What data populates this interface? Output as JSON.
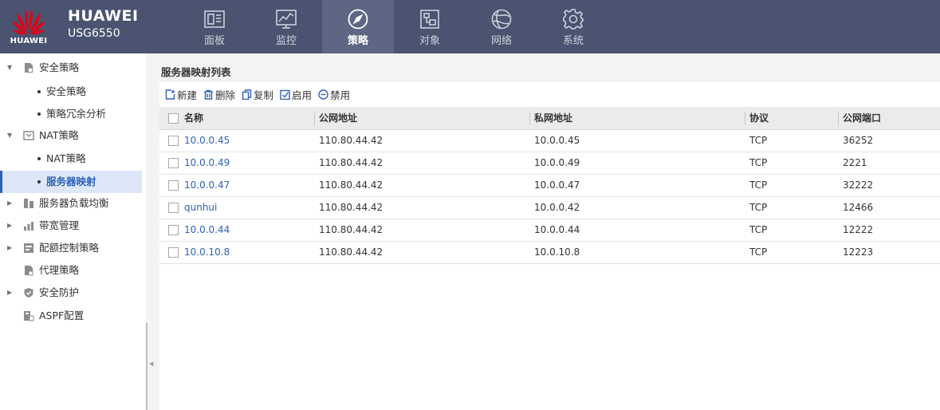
{
  "header": {
    "logo_text": "HUAWEI",
    "brand_name": "HUAWEI",
    "model": "USG6550",
    "brand_color": "#e60012",
    "nav": [
      {
        "label": "面板",
        "icon": "dashboard-icon",
        "active": false
      },
      {
        "label": "监控",
        "icon": "monitor-chart-icon",
        "active": false
      },
      {
        "label": "策略",
        "icon": "compass-icon",
        "active": true
      },
      {
        "label": "对象",
        "icon": "object-icon",
        "active": false
      },
      {
        "label": "网络",
        "icon": "globe-icon",
        "active": false
      },
      {
        "label": "系统",
        "icon": "gear-icon",
        "active": false
      }
    ]
  },
  "sidebar": {
    "items": [
      {
        "label": "安全策略",
        "icon": "security-policy-icon",
        "arrow": "expanded"
      },
      {
        "label": "安全策略",
        "sub": true
      },
      {
        "label": "策略冗余分析",
        "sub": true
      },
      {
        "label": "NAT策略",
        "icon": "nat-icon",
        "arrow": "expanded"
      },
      {
        "label": "NAT策略",
        "sub": true
      },
      {
        "label": "服务器映射",
        "sub": true,
        "selected": true
      },
      {
        "label": "服务器负载均衡",
        "icon": "server-lb-icon",
        "arrow": "collapsed"
      },
      {
        "label": "带宽管理",
        "icon": "bandwidth-icon",
        "arrow": "collapsed"
      },
      {
        "label": "配额控制策略",
        "icon": "quota-icon",
        "arrow": "collapsed"
      },
      {
        "label": "代理策略",
        "icon": "proxy-icon",
        "arrow": "none"
      },
      {
        "label": "安全防护",
        "icon": "shield-icon",
        "arrow": "collapsed"
      },
      {
        "label": "ASPF配置",
        "icon": "aspf-icon",
        "arrow": "none"
      }
    ]
  },
  "main": {
    "title": "服务器映射列表",
    "toolbar": {
      "new_label": "新建",
      "delete_label": "删除",
      "copy_label": "复制",
      "enable_label": "启用",
      "disable_label": "禁用"
    },
    "columns": [
      "名称",
      "公网地址",
      "私网地址",
      "协议",
      "公网端口"
    ],
    "rows": [
      {
        "name": "10.0.0.45",
        "public_ip": "110.80.44.42",
        "private_ip": "10.0.0.45",
        "protocol": "TCP",
        "public_port": "36252"
      },
      {
        "name": "10.0.0.49",
        "public_ip": "110.80.44.42",
        "private_ip": "10.0.0.49",
        "protocol": "TCP",
        "public_port": "2221"
      },
      {
        "name": "10.0.0.47",
        "public_ip": "110.80.44.42",
        "private_ip": "10.0.0.47",
        "protocol": "TCP",
        "public_port": "32222"
      },
      {
        "name": "qunhui",
        "public_ip": "110.80.44.42",
        "private_ip": "10.0.0.42",
        "protocol": "TCP",
        "public_port": "12466"
      },
      {
        "name": "10.0.0.44",
        "public_ip": "110.80.44.42",
        "private_ip": "10.0.0.44",
        "protocol": "TCP",
        "public_port": "12222"
      },
      {
        "name": "10.0.10.8",
        "public_ip": "110.80.44.42",
        "private_ip": "10.0.10.8",
        "protocol": "TCP",
        "public_port": "12223"
      }
    ]
  },
  "colors": {
    "topbar": "#4a5370",
    "link": "#2e62b8",
    "selected_bg": "#dde7f7"
  }
}
